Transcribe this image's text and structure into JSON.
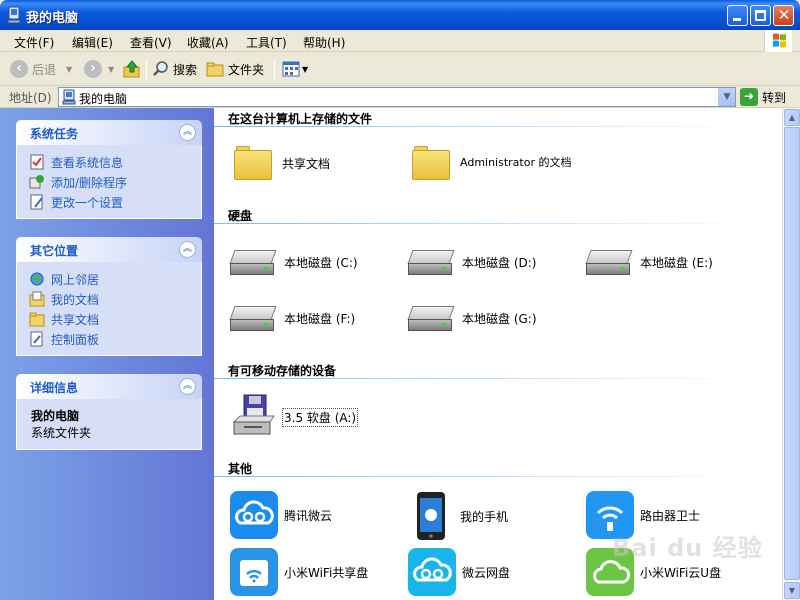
{
  "window": {
    "title": "我的电脑"
  },
  "menu": [
    "文件(F)",
    "编辑(E)",
    "查看(V)",
    "收藏(A)",
    "工具(T)",
    "帮助(H)"
  ],
  "toolbar": {
    "back_label": "后退",
    "search_label": "搜索",
    "folders_label": "文件夹"
  },
  "address": {
    "label": "地址(D)",
    "value": "我的电脑",
    "go_label": "转到"
  },
  "sidebar": {
    "system_tasks": {
      "title": "系统任务",
      "items": [
        "查看系统信息",
        "添加/删除程序",
        "更改一个设置"
      ]
    },
    "other_places": {
      "title": "其它位置",
      "items": [
        "网上邻居",
        "我的文档",
        "共享文档",
        "控制面板"
      ]
    },
    "details": {
      "title": "详细信息",
      "name": "我的电脑",
      "subtitle": "系统文件夹"
    }
  },
  "groups": {
    "stored_files": {
      "title": "在这台计算机上存储的文件",
      "items": [
        "共享文档",
        "Administrator 的文档"
      ]
    },
    "hard_disks": {
      "title": "硬盘",
      "items": [
        "本地磁盘 (C:)",
        "本地磁盘 (D:)",
        "本地磁盘 (E:)",
        "本地磁盘 (F:)",
        "本地磁盘 (G:)"
      ]
    },
    "removable": {
      "title": "有可移动存储的设备",
      "items": [
        "3.5 软盘 (A:)"
      ]
    },
    "other": {
      "title": "其他",
      "items": [
        "腾讯微云",
        "我的手机",
        "路由器卫士",
        "小米WiFi共享盘",
        "微云网盘",
        "小米WiFi云U盘"
      ]
    }
  },
  "watermark": "Bai du 经验",
  "colors": {
    "title_blue": "#0A51D4",
    "sidebar_link": "#215DC6",
    "tencent_cloud": "#1A8CEB",
    "router_guard": "#2196F3",
    "mi_wifi_disk": "#2994E6",
    "weiyun": "#17B5E8",
    "mi_cloud_u": "#6CC644"
  }
}
